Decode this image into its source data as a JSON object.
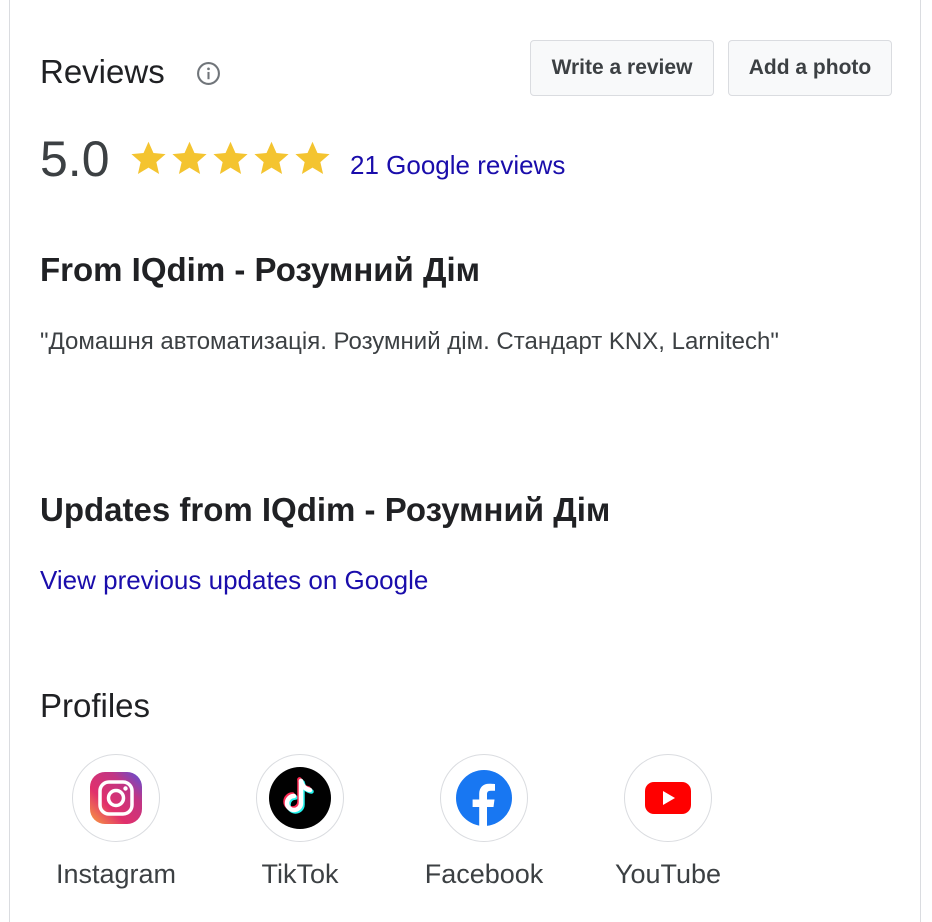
{
  "reviews": {
    "title": "Reviews",
    "write_review_label": "Write a review",
    "add_photo_label": "Add a photo",
    "rating": "5.0",
    "stars_filled": 5,
    "stars_total": 5,
    "count_link": "21 Google reviews",
    "star_color": "#f4c430"
  },
  "from_owner": {
    "title": "From IQdim - Розумний Дім",
    "description": "\"Домашня автоматизація. Розумний дім. Стандарт KNX, Larnitech\""
  },
  "updates": {
    "title": "Updates from IQdim - Розумний Дім",
    "link": "View previous updates on Google"
  },
  "profiles": {
    "title": "Profiles",
    "items": [
      {
        "label": "Instagram",
        "icon": "instagram-icon"
      },
      {
        "label": "TikTok",
        "icon": "tiktok-icon"
      },
      {
        "label": "Facebook",
        "icon": "facebook-icon"
      },
      {
        "label": "YouTube",
        "icon": "youtube-icon"
      }
    ]
  },
  "colors": {
    "link": "#1a0dab",
    "facebook": "#1877f2",
    "youtube": "#ff0000"
  }
}
